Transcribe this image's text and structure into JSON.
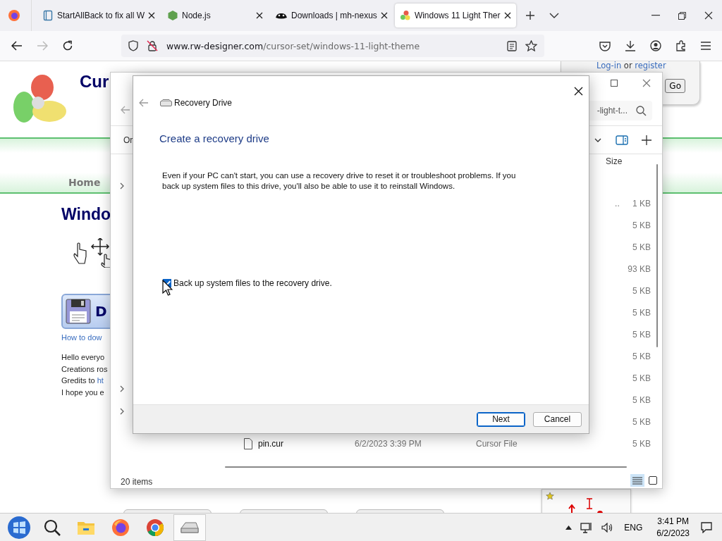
{
  "browser": {
    "tabs": [
      {
        "title": "StartAllBack to fix all W",
        "selected": false
      },
      {
        "title": "Node.js",
        "selected": false
      },
      {
        "title": "Downloads | mh-nexus",
        "selected": false
      },
      {
        "title": "Windows 11 Light Ther",
        "selected": true
      }
    ],
    "address": {
      "domain": "www.rw-designer.com",
      "path": "/cursor-set/windows-11-light-theme"
    }
  },
  "web_page": {
    "site_title": "Cur",
    "login_link": "Log-in",
    "login_or": "or",
    "register_link": "register",
    "go_button": "Go",
    "breadcrumb": "Home",
    "heading": "Windo",
    "download_button": "D",
    "howto_link": "How to dow",
    "paragraph_lines": [
      {
        "text": "Hello everyo"
      },
      {
        "text": "Creations ros"
      },
      {
        "text": "Gredits to ",
        "link": "ht"
      },
      {
        "text": "I hope you e"
      }
    ]
  },
  "explorer": {
    "search_value": "-light-t...",
    "toolbar_label": "Or",
    "size_header": "Size",
    "rows": [
      {
        "name_tail": "..",
        "size": "1 KB"
      },
      {
        "size": "5 KB"
      },
      {
        "size": "5 KB"
      },
      {
        "size": "93 KB"
      },
      {
        "size": "5 KB"
      },
      {
        "size": "5 KB"
      },
      {
        "size": "5 KB"
      },
      {
        "size": "5 KB"
      },
      {
        "size": "5 KB"
      },
      {
        "size": "5 KB"
      },
      {
        "size": "5 KB"
      },
      {
        "name": "pin.cur",
        "date": "6/2/2023 3:39 PM",
        "type": "Cursor File",
        "size": "5 KB"
      }
    ],
    "status": "20 items"
  },
  "dialog": {
    "title": "Recovery Drive",
    "heading": "Create a recovery drive",
    "body": "Even if your PC can't start, you can use a recovery drive to reset it or troubleshoot problems. If you back up system files to this drive, you'll also be able to use it to reinstall Windows.",
    "checkbox": {
      "label": "Back up system files to the recovery drive.",
      "checked": true
    },
    "buttons": [
      {
        "label": "Next",
        "default": true
      },
      {
        "label": "Cancel",
        "default": false
      }
    ]
  },
  "taskbar": {
    "apps": [
      {
        "kind": "folder",
        "active": false
      },
      {
        "kind": "firefox",
        "active": false
      },
      {
        "kind": "chrome",
        "active": false
      },
      {
        "kind": "drive",
        "active": true
      }
    ],
    "language": "ENG",
    "time": "3:41 PM",
    "date": "6/2/2023"
  }
}
